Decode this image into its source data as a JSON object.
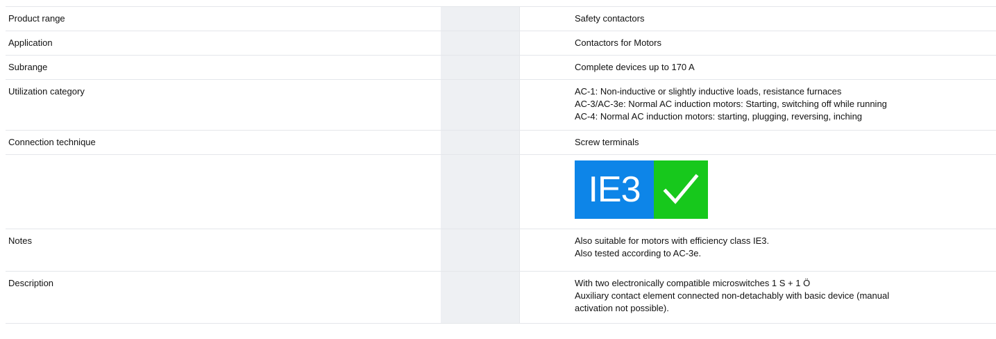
{
  "specs": {
    "rows": [
      {
        "label": "Product range",
        "values": [
          "Safety contactors"
        ]
      },
      {
        "label": "Application",
        "values": [
          "Contactors for Motors"
        ]
      },
      {
        "label": "Subrange",
        "values": [
          "Complete devices up to 170 A"
        ]
      },
      {
        "label": "Utilization category",
        "values": [
          "AC-1: Non-inductive or slightly inductive loads, resistance furnaces",
          "AC-3/AC-3e: Normal AC induction motors: Starting, switching off while running",
          "AC-4: Normal AC induction motors: starting, plugging, reversing, inching"
        ]
      },
      {
        "label": "Connection technique",
        "values": [
          "Screw terminals"
        ]
      },
      {
        "label": "",
        "badge": {
          "text": "IE3",
          "icon": "checkmark-icon",
          "text_bg": "#0d85e8",
          "check_bg": "#17c81c"
        }
      },
      {
        "label": "Notes",
        "values": [
          "Also suitable for motors with efficiency class IE3.",
          "Also tested according to AC-3e."
        ]
      },
      {
        "label": "Description",
        "values": [
          "With two electronically compatible microswitches 1 S + 1 Ö",
          "Auxiliary contact element connected non-detachably with basic device (manual",
          "activation not possible)."
        ]
      }
    ]
  },
  "colors": {
    "heading": "#0a5db8",
    "row_border": "#e4e6ea",
    "shaded_column": "#eef0f3"
  }
}
